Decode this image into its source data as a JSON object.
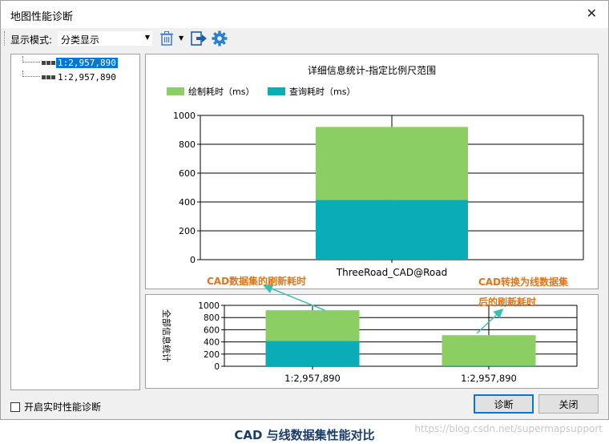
{
  "window": {
    "title": "地图性能诊断",
    "close_glyph": "✕"
  },
  "toolbar": {
    "mode_label": "显示模式:",
    "mode_value": "分类显示"
  },
  "tree": {
    "items": [
      {
        "label": "1:2,957,890",
        "selected": true
      },
      {
        "label": "1:2,957,890",
        "selected": false
      }
    ]
  },
  "top_chart": {
    "title": "详细信息统计-指定比例尺范围",
    "legend": [
      "绘制耗时（ms）",
      "查询耗时（ms）"
    ],
    "y_ticks": [
      "1000",
      "800",
      "600",
      "400",
      "200",
      "0"
    ],
    "category": "ThreeRoad_CAD@Road"
  },
  "bottom_chart": {
    "ylabel": "全部信息统计",
    "y_ticks": [
      "1000",
      "800",
      "600",
      "400",
      "200",
      "0"
    ],
    "categories": [
      "1:2,957,890",
      "1:2,957,890"
    ]
  },
  "annotations": {
    "left": "CAD数据集的刷新耗时",
    "right_line1": "CAD转换为线数据集",
    "right_line2": "后的刷新耗时"
  },
  "footer": {
    "realtime_label": "开启实时性能诊断",
    "diagnose_button": "诊断",
    "close_button": "关闭"
  },
  "caption": "CAD 与线数据集性能对比",
  "watermark": "https://blog.csdn.net/supermapsupport",
  "colors": {
    "draw": "#8bce64",
    "query": "#0aacb8",
    "annotation": "#e07418",
    "arrow": "#3bbfb5"
  },
  "chart_data": [
    {
      "type": "bar",
      "stacked": true,
      "title": "详细信息统计-指定比例尺范围",
      "categories": [
        "ThreeRoad_CAD@Road"
      ],
      "series": [
        {
          "name": "查询耗时（ms）",
          "values": [
            415
          ]
        },
        {
          "name": "绘制耗时（ms）",
          "values": [
            505
          ]
        }
      ],
      "ylim": [
        0,
        1000
      ],
      "grid": true,
      "legend": "top-left"
    },
    {
      "type": "bar",
      "stacked": true,
      "ylabel": "全部信息统计",
      "categories": [
        "1:2,957,890",
        "1:2,957,890"
      ],
      "series": [
        {
          "name": "查询耗时（ms）",
          "values": [
            415,
            5
          ]
        },
        {
          "name": "绘制耗时（ms）",
          "values": [
            505,
            505
          ]
        }
      ],
      "ylim": [
        0,
        1000
      ],
      "grid": true
    }
  ]
}
